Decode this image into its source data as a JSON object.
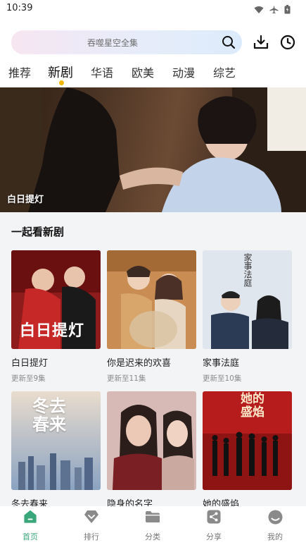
{
  "status": {
    "time": "10:39"
  },
  "search": {
    "placeholder": "吞噬星空全集"
  },
  "tabs": [
    {
      "label": "推荐"
    },
    {
      "label": "新剧"
    },
    {
      "label": "华语"
    },
    {
      "label": "欧美"
    },
    {
      "label": "动漫"
    },
    {
      "label": "综艺"
    }
  ],
  "banner": {
    "caption": "白日提灯"
  },
  "section": {
    "title": "一起看新剧"
  },
  "cards": [
    {
      "title": "白日提灯",
      "sub": "更新至9集",
      "poster_text": "白日提灯"
    },
    {
      "title": "你是迟来的欢喜",
      "sub": "更新至11集",
      "poster_text": ""
    },
    {
      "title": "家事法庭",
      "sub": "更新至10集",
      "poster_text": "家事法庭"
    },
    {
      "title": "冬去春来",
      "sub": "",
      "poster_text": "冬去春来"
    },
    {
      "title": "隐身的名字",
      "sub": "",
      "poster_text": ""
    },
    {
      "title": "她的盛焰",
      "sub": "",
      "poster_text": "她的盛焰"
    }
  ],
  "bottom_nav": [
    {
      "label": "首页"
    },
    {
      "label": "排行"
    },
    {
      "label": "分类"
    },
    {
      "label": "分享"
    },
    {
      "label": "我的"
    }
  ],
  "colors": {
    "accent": "#3aa77a",
    "tab_dot": "#f4b400"
  }
}
